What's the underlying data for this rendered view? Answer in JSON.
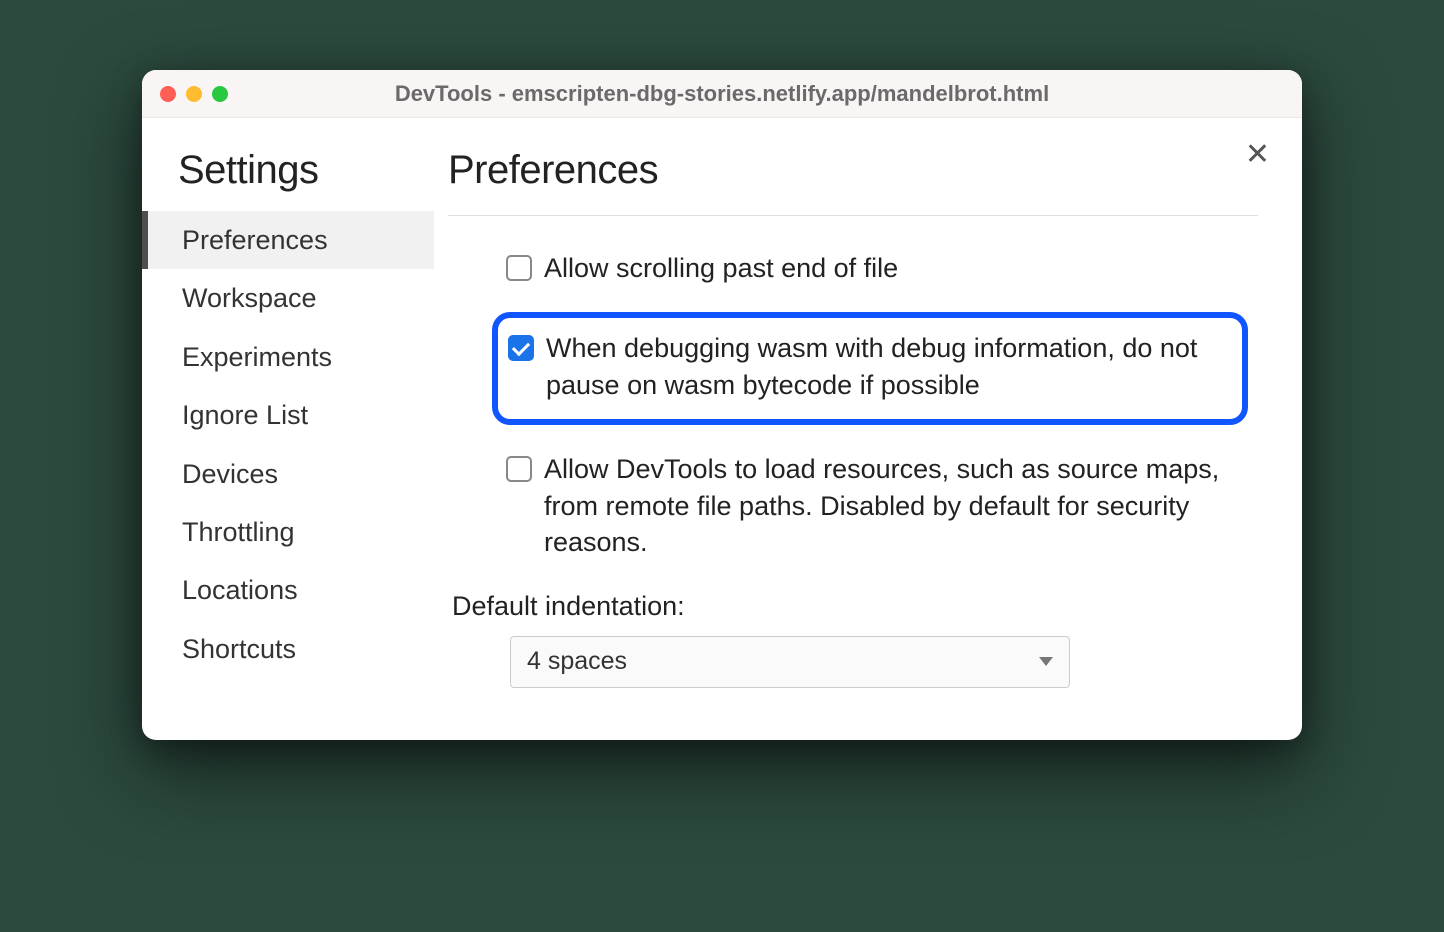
{
  "window": {
    "title": "DevTools - emscripten-dbg-stories.netlify.app/mandelbrot.html"
  },
  "sidebar": {
    "title": "Settings",
    "items": [
      {
        "label": "Preferences",
        "active": true
      },
      {
        "label": "Workspace",
        "active": false
      },
      {
        "label": "Experiments",
        "active": false
      },
      {
        "label": "Ignore List",
        "active": false
      },
      {
        "label": "Devices",
        "active": false
      },
      {
        "label": "Throttling",
        "active": false
      },
      {
        "label": "Locations",
        "active": false
      },
      {
        "label": "Shortcuts",
        "active": false
      }
    ]
  },
  "main": {
    "title": "Preferences",
    "prefs": [
      {
        "label": "Allow scrolling past end of file",
        "checked": false,
        "highlighted": false
      },
      {
        "label": "When debugging wasm with debug information, do not pause on wasm bytecode if possible",
        "checked": true,
        "highlighted": true
      },
      {
        "label": "Allow DevTools to load resources, such as source maps, from remote file paths. Disabled by default for security reasons.",
        "checked": false,
        "highlighted": false
      }
    ],
    "indentation": {
      "label": "Default indentation:",
      "value": "4 spaces"
    }
  }
}
